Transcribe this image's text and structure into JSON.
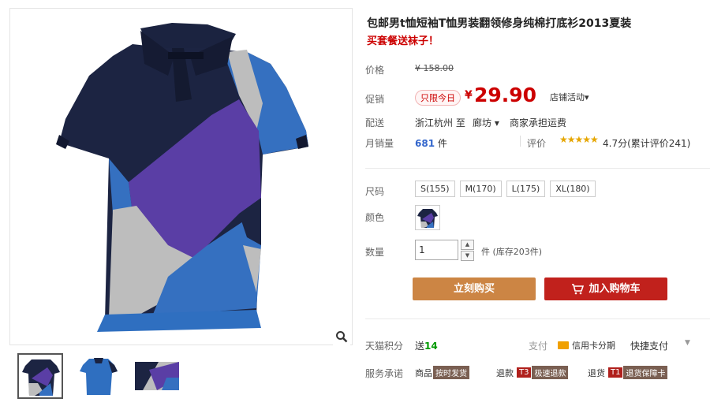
{
  "product": {
    "title": "包邮男t恤短袖T恤男装翻领修身纯棉打底衫2013夏装",
    "subtitle": "买套餐送袜子！"
  },
  "price": {
    "label": "价格",
    "value": "¥ 158.00"
  },
  "promo": {
    "label": "促销",
    "tag": "只限今日",
    "currency": "¥",
    "value": "29.90",
    "shop_activity": "店铺活动▾"
  },
  "shipping": {
    "label": "配送",
    "from": "浙江杭州 至",
    "destination": "廊坊 ▾",
    "fee": "商家承担运费"
  },
  "sales": {
    "label": "月销量",
    "count": "681",
    "unit": "件",
    "rating_label": "评价",
    "stars": "★★★★★",
    "rating_text": "4.7分(累计评价241)"
  },
  "size": {
    "label": "尺码",
    "options": [
      "S(155)",
      "M(170)",
      "L(175)",
      "XL(180)"
    ]
  },
  "color": {
    "label": "颜色"
  },
  "quantity": {
    "label": "数量",
    "value": "1",
    "stock": "件 (库存203件)"
  },
  "actions": {
    "buy_now": "立刻购买",
    "add_cart": "加入购物车"
  },
  "points": {
    "label": "天猫积分",
    "prefix": "送",
    "value": "14"
  },
  "payment": {
    "label": "支付",
    "credit": "信用卡分期",
    "quick": "快捷支付",
    "more": "▼"
  },
  "service": {
    "label": "服务承诺",
    "goods_prefix": "商品",
    "goods_badge": "按时发货",
    "refund_prefix": "退款",
    "refund_t": "T3",
    "refund_badge": "极速退款",
    "return_prefix": "退货",
    "return_t": "T1",
    "return_badge": "退货保障卡"
  },
  "colors": {
    "promo_red": "#c00000",
    "buy_now": "#cc8544",
    "add_cart": "#c1211c",
    "shirt_navy": "#1b2340",
    "shirt_blue": "#2f6fc0",
    "shirt_purple": "#5b3fa6",
    "shirt_grey": "#b8b8b8"
  }
}
